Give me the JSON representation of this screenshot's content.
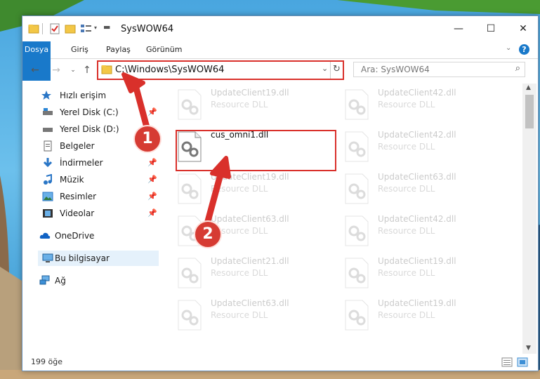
{
  "window": {
    "title": "SysWOW64"
  },
  "ribbon": {
    "tabs": [
      "Dosya",
      "Giriş",
      "Paylaş",
      "Görünüm"
    ]
  },
  "address": {
    "path": "C:\\Windows\\SysWOW64"
  },
  "search": {
    "placeholder": "Ara: SysWOW64"
  },
  "sidebar": {
    "items": [
      {
        "label": "Hızlı erişim",
        "icon": "star-icon"
      },
      {
        "label": "Yerel Disk (C:)",
        "icon": "drive-icon",
        "pinned": true
      },
      {
        "label": "Yerel Disk (D:)",
        "icon": "drive-icon"
      },
      {
        "label": "Belgeler",
        "icon": "document-icon"
      },
      {
        "label": "İndirmeler",
        "icon": "download-icon",
        "pinned": true
      },
      {
        "label": "Müzik",
        "icon": "music-icon",
        "pinned": true
      },
      {
        "label": "Resimler",
        "icon": "pictures-icon",
        "pinned": true
      },
      {
        "label": "Videolar",
        "icon": "video-icon",
        "pinned": true
      },
      {
        "label": "OneDrive",
        "icon": "cloud-icon"
      },
      {
        "label": "Bu bilgisayar",
        "icon": "computer-icon",
        "selected": true
      },
      {
        "label": "Ağ",
        "icon": "network-icon"
      }
    ]
  },
  "files": {
    "left": [
      {
        "name": "UpdateClient19.dll",
        "type": "Resource DLL",
        "faded": true
      },
      {
        "name": "cus_omni1.dll",
        "type": "",
        "faded": false
      },
      {
        "name": "UpdateClient19.dll",
        "type": "Resource DLL",
        "faded": true
      },
      {
        "name": "UpdateClient63.dll",
        "type": "Resource DLL",
        "faded": true
      },
      {
        "name": "UpdateClient21.dll",
        "type": "Resource DLL",
        "faded": true
      },
      {
        "name": "UpdateClient63.dll",
        "type": "Resource DLL",
        "faded": true
      }
    ],
    "right": [
      {
        "name": "UpdateClient42.dll",
        "type": "Resource DLL",
        "faded": true
      },
      {
        "name": "UpdateClient42.dll",
        "type": "Resource DLL",
        "faded": true
      },
      {
        "name": "UpdateClient63.dll",
        "type": "Resource DLL",
        "faded": true
      },
      {
        "name": "UpdateClient42.dll",
        "type": "Resource DLL",
        "faded": true
      },
      {
        "name": "UpdateClient19.dll",
        "type": "Resource DLL",
        "faded": true
      },
      {
        "name": "UpdateClient19.dll",
        "type": "Resource DLL",
        "faded": true
      }
    ]
  },
  "status": {
    "count": "199 öğe"
  },
  "annotations": {
    "badge1": "1",
    "badge2": "2",
    "color": "#d9302b"
  }
}
